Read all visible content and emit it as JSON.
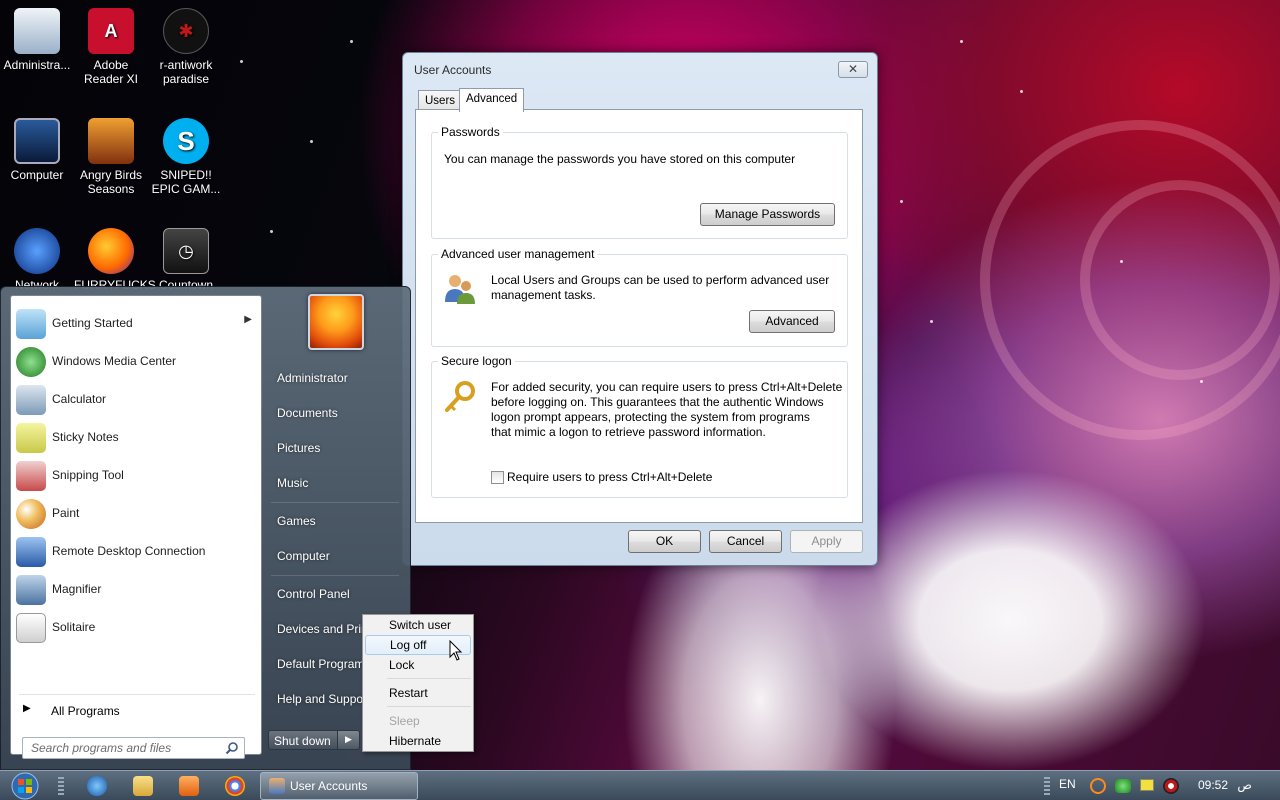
{
  "desktop": {
    "icons": [
      {
        "label": "Administra...",
        "label2": "",
        "icon": "user-folder-icon"
      },
      {
        "label": "Adobe",
        "label2": "Reader XI",
        "icon": "adobe-reader-icon"
      },
      {
        "label": "r-antiwork",
        "label2": "paradise",
        "icon": "reddit-game-icon"
      },
      {
        "label": "Computer",
        "label2": "",
        "icon": "computer-icon"
      },
      {
        "label": "Angry Birds",
        "label2": "Seasons",
        "icon": "angry-birds-icon"
      },
      {
        "label": "SNIPED!!",
        "label2": "EPIC GAM...",
        "icon": "skype-icon"
      },
      {
        "label": "Network",
        "label2": "",
        "icon": "network-icon"
      },
      {
        "label": "FURRYFUCKS",
        "label2": "",
        "icon": "firefox-icon"
      },
      {
        "label": "Countown",
        "label2": "",
        "icon": "clock-icon"
      }
    ]
  },
  "dialog": {
    "title": "User Accounts",
    "close_label": "✕",
    "tabs": [
      {
        "label": "Users"
      },
      {
        "label": "Advanced"
      }
    ],
    "active_tab": "Advanced",
    "passwords": {
      "legend": "Passwords",
      "text": "You can manage the passwords you have stored on this computer",
      "button": "Manage Passwords"
    },
    "advanced_mgmt": {
      "legend": "Advanced user management",
      "text1": "Local Users and Groups can be used to perform advanced user",
      "text2": "management tasks.",
      "button": "Advanced"
    },
    "secure_logon": {
      "legend": "Secure logon",
      "text1": "For added security, you can require users to press Ctrl+Alt+Delete",
      "text2": "before logging on. This guarantees that the authentic Windows",
      "text3": "logon prompt appears, protecting the system from programs",
      "text4": "that mimic a logon to retrieve password information.",
      "checkbox_label": "Require users to press Ctrl+Alt+Delete",
      "checked": false
    },
    "buttons": {
      "ok": "OK",
      "cancel": "Cancel",
      "apply": "Apply"
    }
  },
  "start_menu": {
    "programs": [
      {
        "label": "Getting Started",
        "icon": "getting-started-icon",
        "color": "#6fb3e0",
        "has_submenu": true
      },
      {
        "label": "Windows Media Center",
        "icon": "media-center-icon",
        "color": "#3aa33a",
        "has_submenu": false
      },
      {
        "label": "Calculator",
        "icon": "calculator-icon",
        "color": "#7c9ab8",
        "has_submenu": false
      },
      {
        "label": "Sticky Notes",
        "icon": "sticky-notes-icon",
        "color": "#d8d85a",
        "has_submenu": false
      },
      {
        "label": "Snipping Tool",
        "icon": "snipping-tool-icon",
        "color": "#c84a4a",
        "has_submenu": false
      },
      {
        "label": "Paint",
        "icon": "paint-icon",
        "color": "#e8a040",
        "has_submenu": false
      },
      {
        "label": "Remote Desktop Connection",
        "icon": "remote-desktop-icon",
        "color": "#3a6cb8",
        "has_submenu": false
      },
      {
        "label": "Magnifier",
        "icon": "magnifier-icon",
        "color": "#5a82b0",
        "has_submenu": false
      },
      {
        "label": "Solitaire",
        "icon": "solitaire-icon",
        "color": "#e0e0e0",
        "has_submenu": false
      }
    ],
    "all_programs": "All Programs",
    "search_placeholder": "Search programs and files",
    "right_items": [
      {
        "label": "Administrator"
      },
      {
        "label": "Documents"
      },
      {
        "label": "Pictures"
      },
      {
        "label": "Music"
      },
      {
        "label": "Games"
      },
      {
        "label": "Computer"
      },
      {
        "label": "Control Panel"
      },
      {
        "label": "Devices and Printers"
      },
      {
        "label": "Default Programs"
      },
      {
        "label": "Help and Support"
      }
    ],
    "shutdown_label": "Shut down"
  },
  "power_menu": {
    "items": [
      {
        "label": "Switch user",
        "enabled": true
      },
      {
        "label": "Log off",
        "enabled": true,
        "hover": true
      },
      {
        "label": "Lock",
        "enabled": true
      },
      {
        "label": "Restart",
        "enabled": true
      },
      {
        "label": "Sleep",
        "enabled": false
      },
      {
        "label": "Hibernate",
        "enabled": true
      }
    ]
  },
  "taskbar": {
    "task_label": "User Accounts",
    "language": "EN",
    "time": "09:52",
    "ampm": "ص"
  }
}
